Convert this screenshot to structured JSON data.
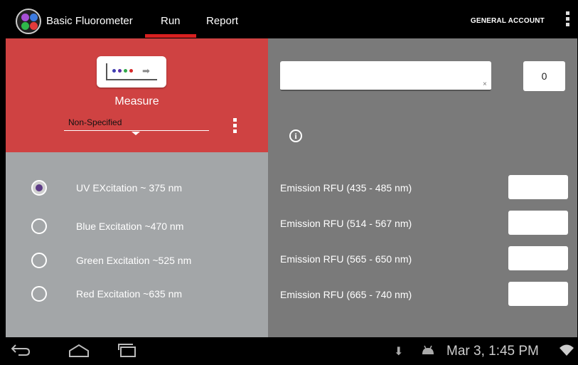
{
  "app": {
    "title": "Basic Fluorometer",
    "account": "GENERAL ACCOUNT",
    "logo_colors": [
      "#a64fd6",
      "#3d7be0",
      "#2eb84a",
      "#e23b3b"
    ]
  },
  "tabs": [
    {
      "label": "Run",
      "active": true
    },
    {
      "label": "Report",
      "active": false
    }
  ],
  "measure": {
    "label": "Measure",
    "spinner_value": "Non-Specified",
    "icon_dot_colors": [
      "#3d3db0",
      "#5a2ea8",
      "#2fa84a",
      "#d62a2a"
    ]
  },
  "sample": {
    "input_value": "",
    "clear_symbol": "×",
    "count": "0",
    "info_icon": "info-icon"
  },
  "excitations": [
    {
      "label": "UV EXcitation ~ 375 nm",
      "selected": true
    },
    {
      "label": "Blue Excitation ~470 nm",
      "selected": false
    },
    {
      "label": "Green Excitation ~525 nm",
      "selected": false
    },
    {
      "label": "Red Excitation ~635 nm",
      "selected": false
    }
  ],
  "emissions": [
    {
      "label": "Emission RFU (435 - 485 nm)",
      "value": ""
    },
    {
      "label": "Emission RFU (514 - 567 nm)",
      "value": ""
    },
    {
      "label": "Emission RFU (565 - 650 nm)",
      "value": ""
    },
    {
      "label": "Emission RFU (665 - 740 nm)",
      "value": ""
    }
  ],
  "system": {
    "clock": "Mar 3, 1:45 PM"
  },
  "colors": {
    "measure_panel": "#cf4242",
    "tab_indicator": "#d81f1f",
    "right_panel": "#7a7a7a",
    "excitation_panel": "#a3a6a8",
    "radio_selected": "#5d3b86"
  }
}
